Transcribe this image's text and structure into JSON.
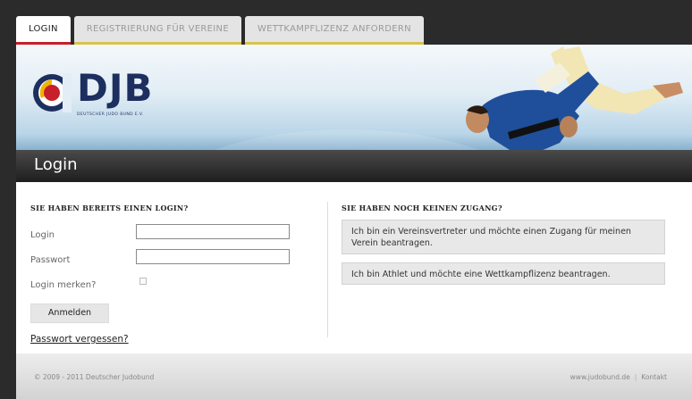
{
  "tabs": [
    {
      "label": "LOGIN",
      "active": true
    },
    {
      "label": "REGISTRIERUNG FÜR VEREINE",
      "active": false
    },
    {
      "label": "WETTKAMPFLIZENZ ANFORDERN",
      "active": false
    }
  ],
  "logo": {
    "text": "DJB",
    "subtitle": "DEUTSCHER JUDO BUND E.V."
  },
  "header": {
    "title": "Login"
  },
  "login_form": {
    "title": "SIE HABEN BEREITS EINEN LOGIN?",
    "login_label": "Login",
    "login_value": "",
    "password_label": "Passwort",
    "password_value": "",
    "remember_label": "Login merken?",
    "submit_label": "Anmelden",
    "forgot_link": "Passwort vergessen?"
  },
  "no_access": {
    "title": "SIE HABEN NOCH KEINEN ZUGANG?",
    "options": [
      "Ich bin ein Vereinsvertreter und möchte einen Zugang für meinen Verein beantragen.",
      "Ich bin Athlet und möchte eine Wettkampflizenz beantragen."
    ]
  },
  "footer": {
    "copyright": "© 2009 - 2011 Deutscher Judobund",
    "links": [
      "www.judobund.de",
      "Kontakt"
    ]
  },
  "colors": {
    "brand_red": "#c8202a",
    "brand_blue": "#1c2f5e",
    "tab_accent": "#d8c24a",
    "login_bar": "#1e1e1e"
  }
}
